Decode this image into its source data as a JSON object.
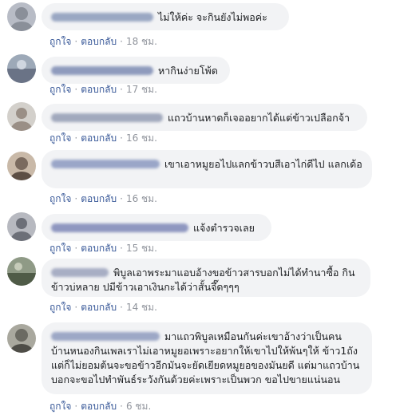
{
  "colors": {
    "bubble": "#f2f3f5",
    "action_link": "#385898",
    "time": "#90949c"
  },
  "actions": {
    "like": "ถูกใจ",
    "reply": "ตอบกลับ",
    "separator": "·"
  },
  "comments": [
    {
      "text": "ไม่ให้ค่ะ จะกินยังไม่พอค่ะ",
      "time": "18 ชม.",
      "avatar_color": "#8a8f99",
      "name_color": "#9aa7c3"
    },
    {
      "text": "หากินง่ายโพ้ด",
      "time": "17 ชม.",
      "avatar_color": "#6a7386",
      "name_color": "#8f9bbd"
    },
    {
      "text": "แถวบ้านหาดก็เจออยากได้แต่ข้าวเปลือกจ้า",
      "time": "16 ชม.",
      "avatar_color": "#9a8f86",
      "name_color": "#a2a9bd"
    },
    {
      "text": "เขาเอาหมูยอไปแลกข้าวบสีเอาไก่ดีไป แลกเด้อ",
      "time": "16 ชม.",
      "avatar_color": "#7a6a5e",
      "name_color": "#9aa6c8"
    },
    {
      "text": "แจ้งตำรวจเลย",
      "time": "15 ชม.",
      "avatar_color": "#6c6f78",
      "name_color": "#8f97c0"
    },
    {
      "text": "พิบูลเอาพระมาแอบอ้างขอข้าวสารบอกไม่ได้ทำนาซื้อ กินข้าวบ่หลาย ปมีข้าวเอาเงินกะได้ว่าสั้นจึ๊ดๆๆๆ",
      "time": "14 ชม.",
      "avatar_color": "#4f5b47",
      "name_color": "#a8aec4"
    },
    {
      "text": "มาแถวพิบูลเหมือนกันค่ะเขาอ้างว่าเป็นคน บ้านหนองกินเพลเราไม่เอาหมูยอเพราะอยากให้เขาไปให้พ้นๆให้ ข้าว1ถังแต่ก็ไม่ยอมต้นจะขอข้าวอีกมันจะยัดเยียดหมูยอของมันยดี แต่มาแถวบ้านบอกจะขอไปทำพันธ์ระวังกันด้วยค่ะเพราะเป็นพวก ขอไปขายแน่นอน",
      "time": "6 ชม.",
      "avatar_color": "#6b6a62",
      "name_color": "#9da8c6"
    }
  ]
}
